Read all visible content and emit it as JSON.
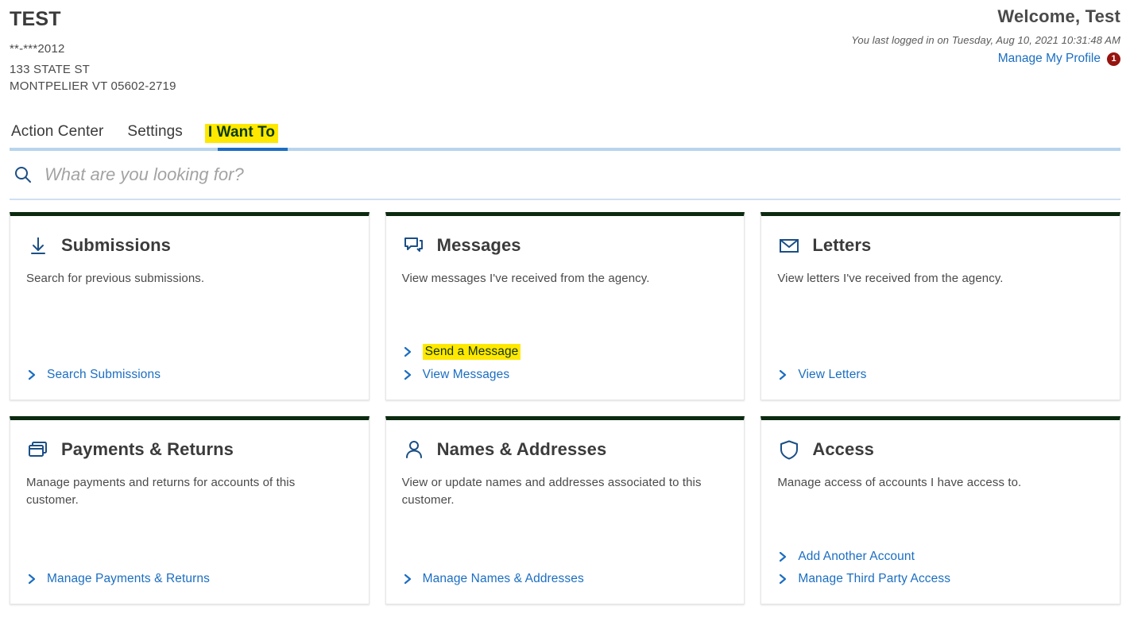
{
  "header": {
    "account_title": "TEST",
    "account_id": "**-***2012",
    "address_line1": "133 STATE ST",
    "address_line2": "MONTPELIER VT 05602-2719",
    "welcome": "Welcome, Test",
    "last_login": "You last logged in on Tuesday, Aug 10, 2021 10:31:48 AM",
    "manage_profile_label": "Manage My Profile",
    "profile_badge_count": "1",
    "badge_color": "#96130f",
    "link_color": "#1b6ec2"
  },
  "tabs": {
    "items": [
      {
        "label": "Action Center",
        "active": false,
        "highlighted": false
      },
      {
        "label": "Settings",
        "active": false,
        "highlighted": false
      },
      {
        "label": "I Want To",
        "active": true,
        "highlighted": true
      }
    ],
    "highlight_color": "#ffe800",
    "active_underline_color": "#1b6ec2",
    "rail_color": "#b7d5ee"
  },
  "search": {
    "placeholder": "What are you looking for?",
    "value": "",
    "icon": "search-icon"
  },
  "cards": [
    {
      "id": "submissions",
      "icon": "download-arrow-icon",
      "title": "Submissions",
      "description": "Search for previous submissions.",
      "links": [
        {
          "label": "Search Submissions",
          "highlighted": false
        }
      ]
    },
    {
      "id": "messages",
      "icon": "speech-bubbles-icon",
      "title": "Messages",
      "description": "View messages I've received from the agency.",
      "links": [
        {
          "label": "Send a Message",
          "highlighted": true
        },
        {
          "label": "View Messages",
          "highlighted": false
        }
      ]
    },
    {
      "id": "letters",
      "icon": "envelope-icon",
      "title": "Letters",
      "description": "View letters I've received from the agency.",
      "links": [
        {
          "label": "View Letters",
          "highlighted": false
        }
      ]
    },
    {
      "id": "payments-returns",
      "icon": "stacked-cards-icon",
      "title": "Payments & Returns",
      "description": "Manage payments and returns for accounts of this customer.",
      "links": [
        {
          "label": "Manage Payments & Returns",
          "highlighted": false
        }
      ]
    },
    {
      "id": "names-addresses",
      "icon": "person-icon",
      "title": "Names & Addresses",
      "description": "View or update names and addresses associated to this customer.",
      "links": [
        {
          "label": "Manage Names & Addresses",
          "highlighted": false
        }
      ]
    },
    {
      "id": "access",
      "icon": "shield-icon",
      "title": "Access",
      "description": "Manage access of accounts I have access to.",
      "links": [
        {
          "label": "Add Another Account",
          "highlighted": false
        },
        {
          "label": "Manage Third Party Access",
          "highlighted": false
        }
      ]
    }
  ],
  "theme": {
    "card_top_border": "#0b2a10",
    "card_border": "#e6e6e6",
    "text_color": "#3b3b3b"
  }
}
